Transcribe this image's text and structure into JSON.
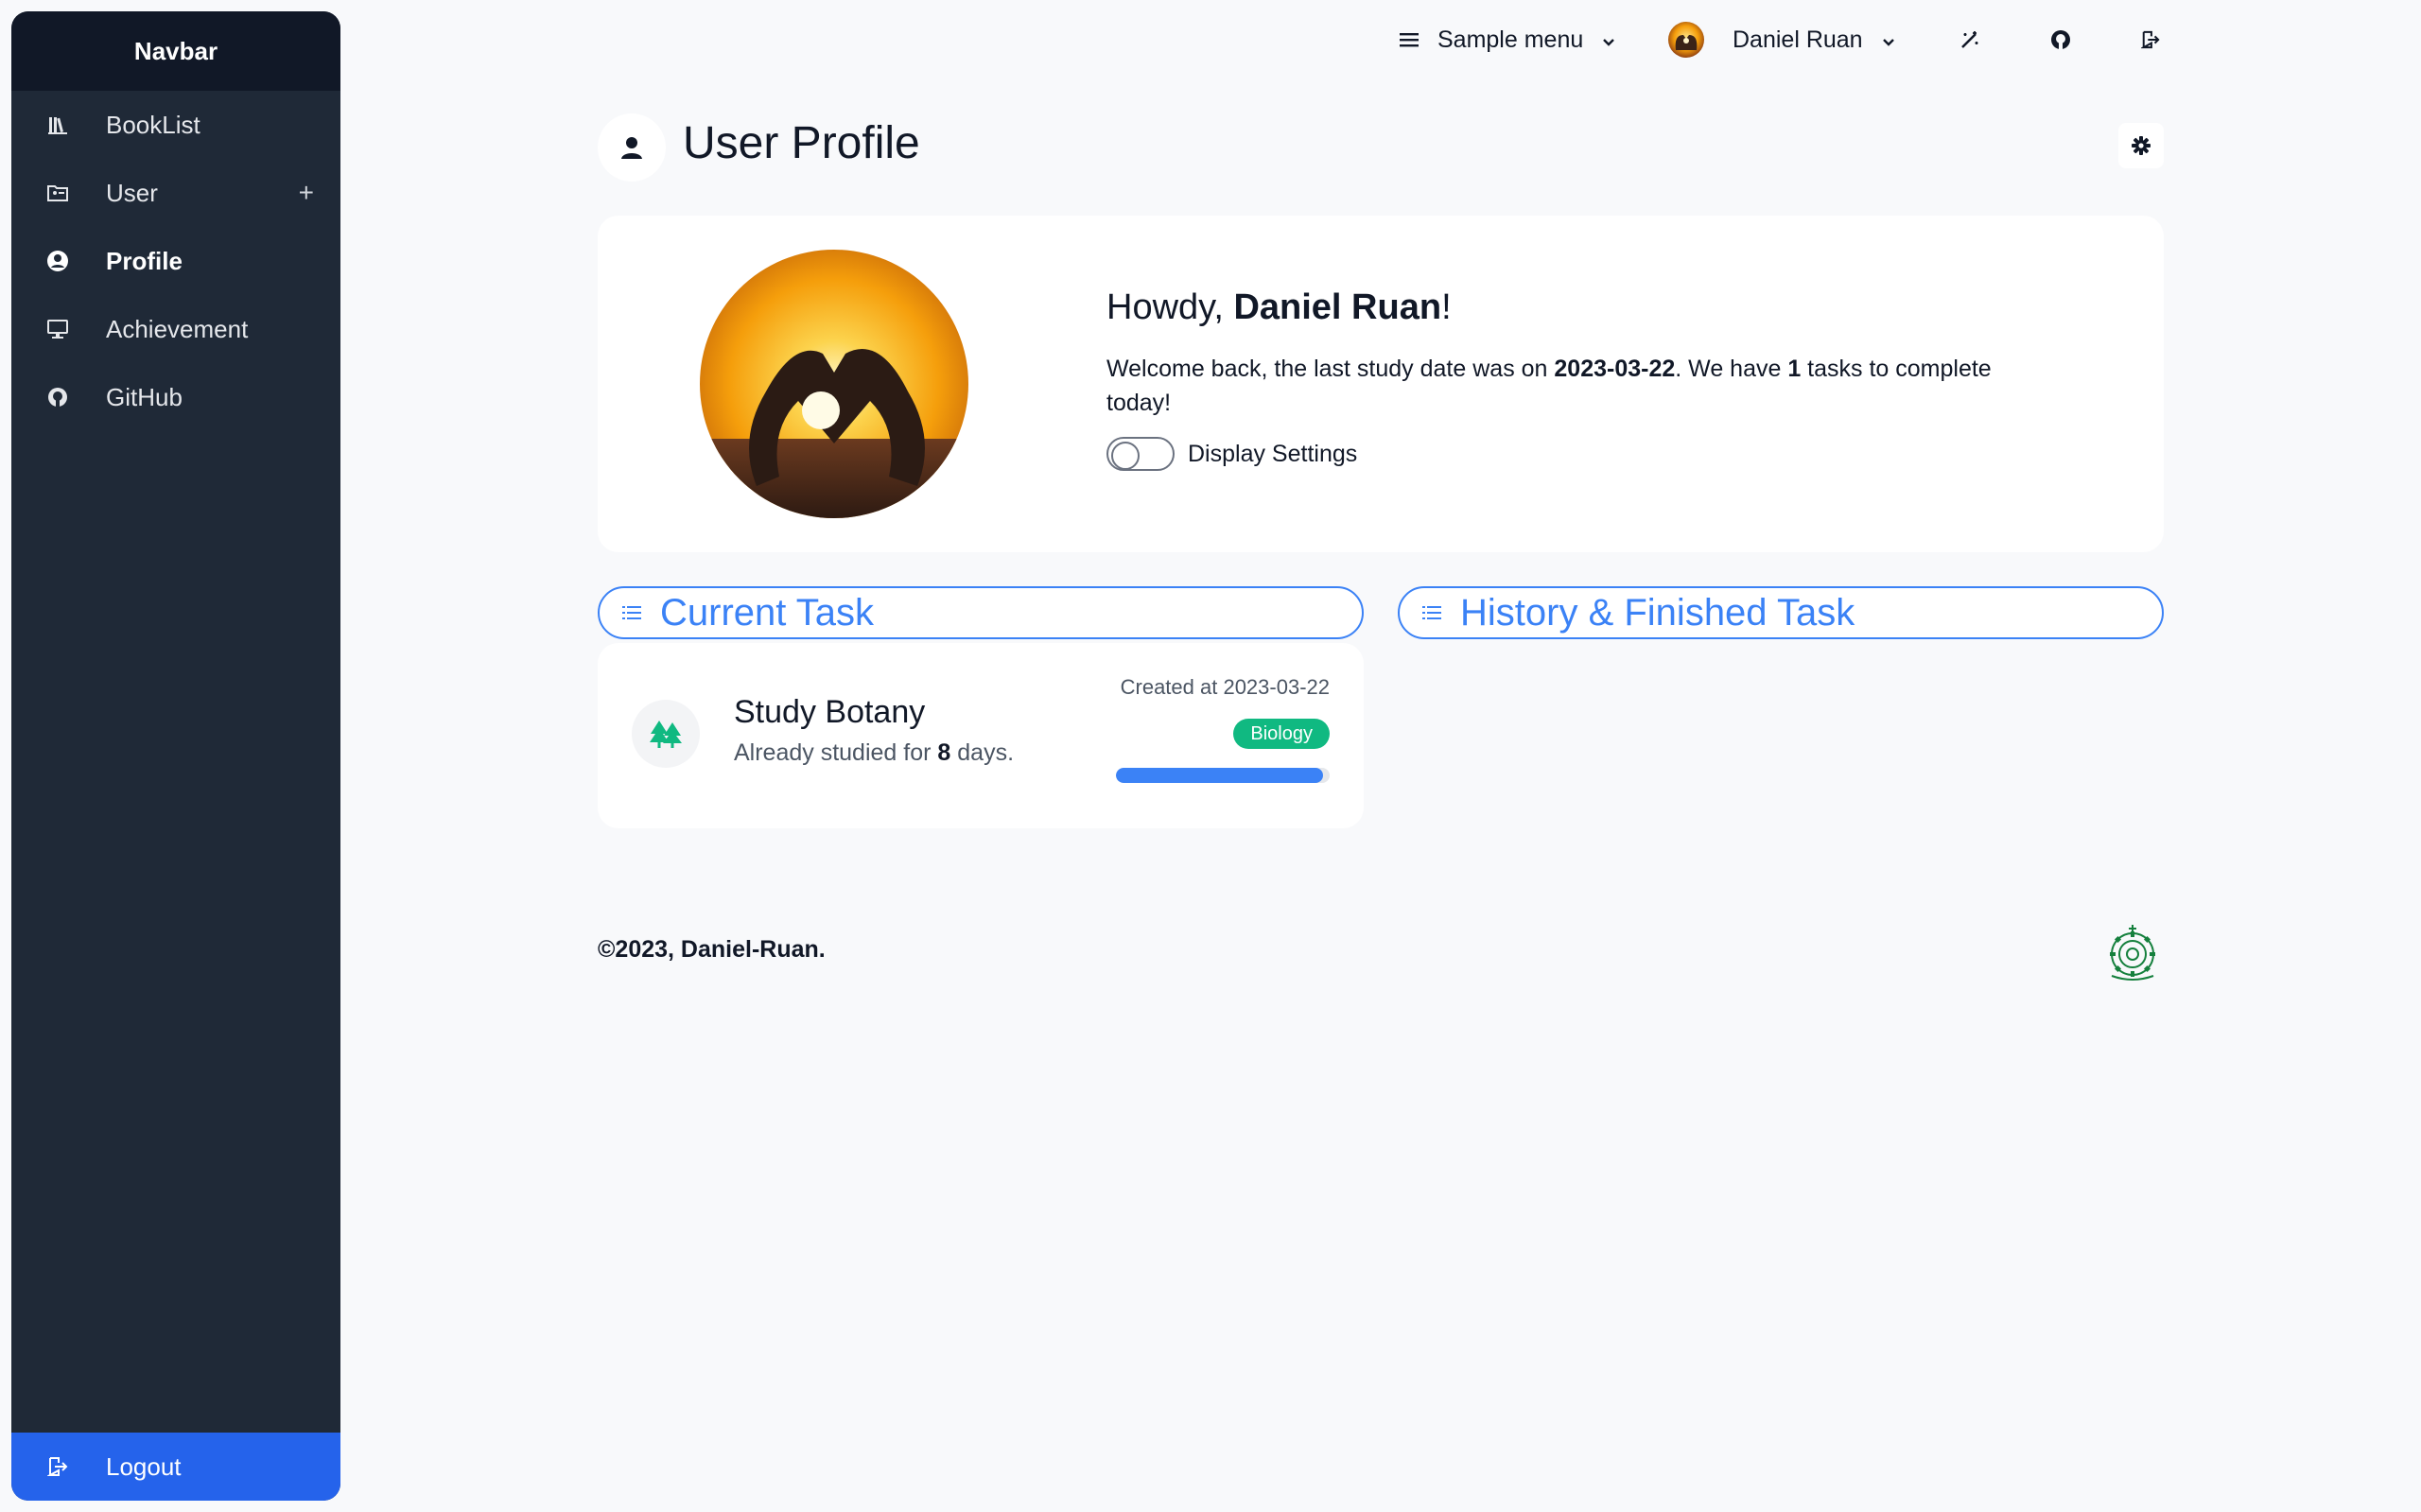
{
  "sidebar": {
    "title": "Navbar",
    "items": [
      {
        "label": "BookList",
        "icon": "library-icon"
      },
      {
        "label": "User",
        "icon": "folder-user-icon",
        "expand": "+"
      },
      {
        "label": "Profile",
        "icon": "user-circle-icon",
        "active": true
      },
      {
        "label": "Achievement",
        "icon": "monitor-icon"
      },
      {
        "label": "GitHub",
        "icon": "github-icon"
      }
    ],
    "logout_label": "Logout"
  },
  "topbar": {
    "menu_label": "Sample menu",
    "user_name": "Daniel Ruan"
  },
  "page": {
    "title": "User Profile"
  },
  "profile": {
    "greeting_prefix": "Howdy, ",
    "name": "Daniel Ruan",
    "greeting_suffix": "!",
    "welcome_prefix": "Welcome back, the last study date was on ",
    "last_study_date": "2023-03-22",
    "welcome_mid": ". We have ",
    "task_count": "1",
    "welcome_suffix": " tasks to complete today!",
    "toggle_label": "Display Settings",
    "toggle_on": false
  },
  "tabs": {
    "current": "Current Task",
    "history": "History & Finished Task"
  },
  "task": {
    "title": "Study Botany",
    "studied_prefix": "Already studied for ",
    "days": "8",
    "studied_suffix": " days.",
    "created": "Created at 2023-03-22",
    "tag": "Biology",
    "progress": 0.97
  },
  "footer": {
    "copyright": "©2023, Daniel-Ruan."
  },
  "colors": {
    "sidebar_bg": "#1f2937",
    "accent": "#2563eb",
    "tab_blue": "#3b82f6",
    "badge_green": "#10b981",
    "tree_green": "#10b981"
  }
}
